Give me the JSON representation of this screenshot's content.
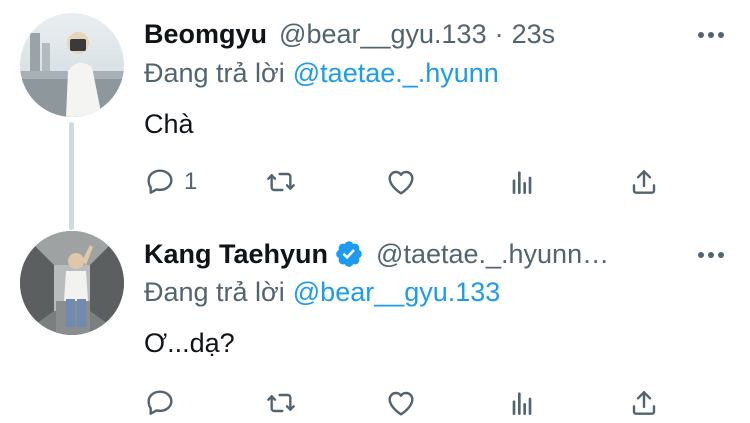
{
  "colors": {
    "link": "#1d9bf0",
    "secondary_text": "#536471",
    "primary_text": "#0f1419",
    "thread_line": "#cfd9de"
  },
  "tweets": [
    {
      "name": "Beomgyu",
      "handle": "@bear__gyu.133",
      "separator": "·",
      "time": "23s",
      "reply_prefix": "Đang trả lời",
      "reply_to": "@taetae._.hyunn",
      "text": "Chà",
      "reply_count": "1",
      "verified": false,
      "icons": [
        "more-icon",
        "reply-icon",
        "retweet-icon",
        "like-icon",
        "stats-icon",
        "share-icon"
      ]
    },
    {
      "name": "Kang Taehyun",
      "handle": "@taetae._.hyunn…",
      "reply_prefix": "Đang trả lời",
      "reply_to": "@bear__gyu.133",
      "text": "Ơ...dạ?",
      "reply_count": "",
      "verified": true,
      "icons": [
        "verified-badge-icon",
        "more-icon",
        "reply-icon",
        "retweet-icon",
        "like-icon",
        "stats-icon",
        "share-icon"
      ]
    }
  ]
}
